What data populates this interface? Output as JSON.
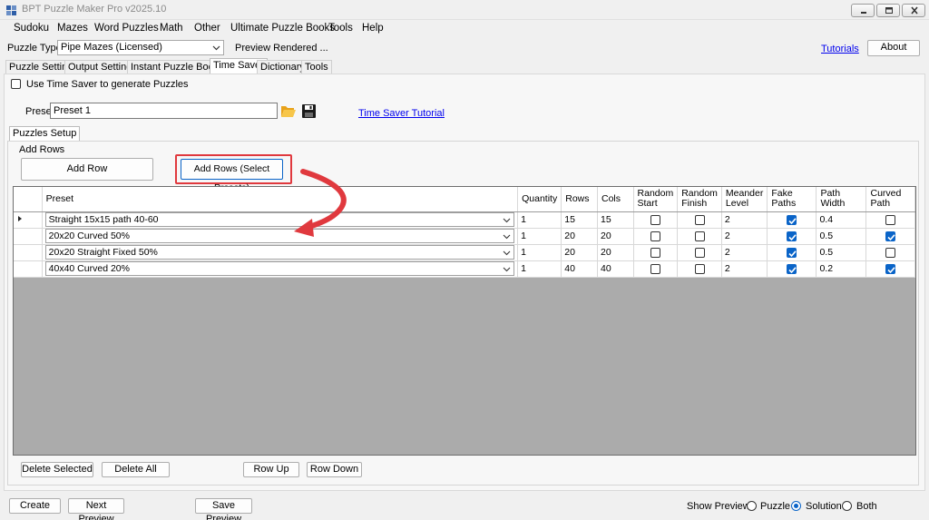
{
  "window": {
    "title": "BPT Puzzle Maker Pro v2025.10"
  },
  "menu": [
    "Sudoku",
    "Mazes",
    "Word Puzzles",
    "Math",
    "Other",
    "Ultimate Puzzle Books",
    "Tools",
    "Help"
  ],
  "toolbar": {
    "puzzle_type_label": "Puzzle Type",
    "puzzle_type_value": "Pipe Mazes (Licensed)",
    "preview_status": "Preview Rendered ...",
    "tutorials_link": "Tutorials",
    "about_button": "About"
  },
  "tabs": [
    "Puzzle Settings",
    "Output Settings",
    "Instant Puzzle Books",
    "Time Saver",
    "Dictionary",
    "Tools"
  ],
  "active_tab": "Time Saver",
  "time_saver": {
    "use_checkbox_label": "Use Time Saver to generate Puzzles",
    "preset_label": "Preset",
    "preset_value": "Preset 1",
    "tutorial_link": "Time Saver Tutorial"
  },
  "inner_tab": "Puzzles Setup",
  "add_rows_group": "Add Rows",
  "add_row_button": "Add Row",
  "add_rows_presets_button": "Add Rows (Select Presets)",
  "grid": {
    "columns": [
      {
        "label": "Preset"
      },
      {
        "label": "Quantity"
      },
      {
        "label": "Rows"
      },
      {
        "label": "Cols"
      },
      {
        "label": "Random Start"
      },
      {
        "label": "Random Finish"
      },
      {
        "label": "Meander Level"
      },
      {
        "label": "Fake Paths"
      },
      {
        "label": "Path Width"
      },
      {
        "label": "Curved Path"
      }
    ],
    "rows": [
      {
        "preset": "Straight 15x15 path 40-60",
        "quantity": "1",
        "rows": "15",
        "cols": "15",
        "random_start": false,
        "random_finish": false,
        "meander": "2",
        "fake_paths": true,
        "path_width": "0.4",
        "curved": false,
        "current": true
      },
      {
        "preset": "20x20 Curved 50%",
        "quantity": "1",
        "rows": "20",
        "cols": "20",
        "random_start": false,
        "random_finish": false,
        "meander": "2",
        "fake_paths": true,
        "path_width": "0.5",
        "curved": true,
        "current": false
      },
      {
        "preset": "20x20 Straight Fixed 50%",
        "quantity": "1",
        "rows": "20",
        "cols": "20",
        "random_start": false,
        "random_finish": false,
        "meander": "2",
        "fake_paths": true,
        "path_width": "0.5",
        "curved": false,
        "current": false
      },
      {
        "preset": "40x40 Curved 20%",
        "quantity": "1",
        "rows": "40",
        "cols": "40",
        "random_start": false,
        "random_finish": false,
        "meander": "2",
        "fake_paths": true,
        "path_width": "0.2",
        "curved": true,
        "current": false
      }
    ]
  },
  "grid_buttons": {
    "delete_selected": "Delete Selected",
    "delete_all": "Delete All",
    "row_up": "Row Up",
    "row_down": "Row Down"
  },
  "bottom": {
    "create": "Create",
    "next_preview": "Next Preview",
    "save_preview": "Save Preview",
    "show_preview_label": "Show Preview:",
    "options": [
      "Puzzle",
      "Solution",
      "Both"
    ],
    "selected_option": "Solution"
  },
  "colors": {
    "highlight": "#e0393e",
    "accent": "#0a64c8",
    "link": "#0000ee"
  }
}
